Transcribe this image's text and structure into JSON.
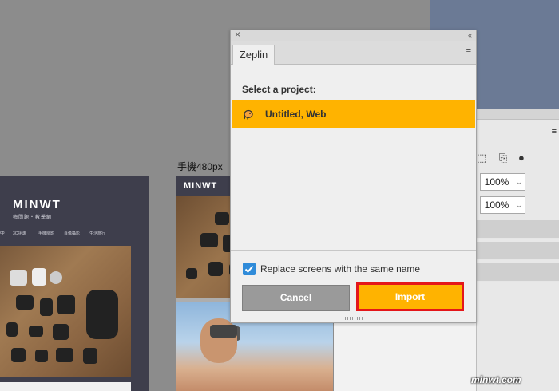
{
  "dialog": {
    "tab_label": "Zeplin",
    "close_glyph": "×",
    "collapse_glyph": "‹‹",
    "menu_glyph": "≡",
    "select_label": "Select a project:",
    "projects": [
      {
        "label": "Untitled, Web",
        "icon": "zeplin-icon",
        "selected": true
      }
    ],
    "replace_checkbox": {
      "label": "Replace screens with the same name",
      "checked": true
    },
    "cancel_label": "Cancel",
    "import_label": "Import"
  },
  "properties_panel": {
    "menu_glyph": "≡",
    "opacity_value": "100%",
    "fill_value": "100%",
    "dropdown_glyph": "⌄"
  },
  "canvas": {
    "artboard_mobile_label": "手機480px",
    "artboard_desktop": {
      "logo": "MINWT",
      "tagline": "梅問題・教學網",
      "nav": [
        "op",
        "3C評測",
        "手機隨影",
        "肖像攝影",
        "生活旅行"
      ]
    },
    "artboard_mobile": {
      "logo": "MINWT"
    }
  },
  "watermark": "minwt.com",
  "colors": {
    "accent_yellow": "#ffb300",
    "highlight_red": "#e4161a",
    "checkbox_blue": "#2f8bd9",
    "cancel_gray": "#9a9a9a"
  }
}
